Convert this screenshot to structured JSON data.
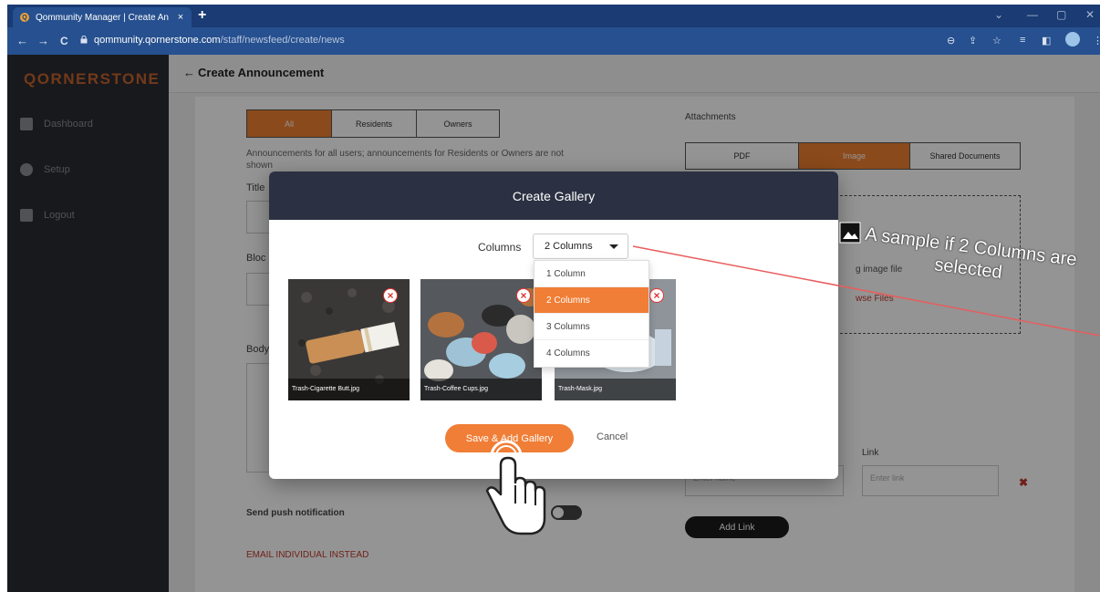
{
  "browser": {
    "tab_title": "Qommunity Manager | Create An",
    "tab_favicon": "Q",
    "tab_close": "×",
    "new_tab": "+",
    "url_host": "qommunity.qornerstone.com",
    "url_path": "/staff/newsfeed/create/news",
    "window_controls": [
      "⌄",
      "—",
      "▢",
      "✕"
    ],
    "nav": [
      "←",
      "→",
      "C"
    ]
  },
  "sidebar": {
    "logo": "QORNERSTONE",
    "items": [
      {
        "label": "Dashboard",
        "icon": "home-icon"
      },
      {
        "label": "Setup",
        "icon": "gear-icon"
      },
      {
        "label": "Logout",
        "icon": "logout-icon"
      }
    ]
  },
  "header": {
    "back": "←",
    "title": "Create Announcement"
  },
  "form": {
    "audience_tabs": [
      "All",
      "Residents",
      "Owners"
    ],
    "audience_selected": "All",
    "audience_note": "Announcements for all users; announcements for Residents or Owners are not shown",
    "title_label": "Title",
    "block_label": "Bloc",
    "body_label": "Body",
    "attachments_label": "Attachments",
    "attachment_tabs": [
      "PDF",
      "Image",
      "Shared Documents"
    ],
    "attachment_selected": "Image",
    "dropzone_text": "g image file",
    "browse_files": "wse Files",
    "link_label": "Link",
    "link_name_placeholder": "Enter name",
    "link_url_placeholder": "Enter link",
    "add_link": "Add Link",
    "send_push": "Send push notification",
    "email_individual": "EMAIL INDIVIDUAL INSTEAD"
  },
  "modal": {
    "title": "Create Gallery",
    "columns_label": "Columns",
    "columns_value": "2 Columns",
    "column_options": [
      "1 Column",
      "2 Columns",
      "3 Columns",
      "4 Columns"
    ],
    "selected_option_index": 1,
    "images": [
      {
        "caption": "Trash-Cigarette Butt.jpg"
      },
      {
        "caption": "Trash-Coffee Cups.jpg"
      },
      {
        "caption": "Trash-Mask.jpg"
      }
    ],
    "delete_symbol": "×",
    "save_button": "Save & Add Gallery",
    "cancel_button": "Cancel"
  },
  "annotation": {
    "text": "A sample if 2 Columns are selected"
  },
  "colors": {
    "accent": "#f07e36",
    "modal_header": "#2b3142",
    "sidebar": "#2a2c33",
    "browser_bar": "#1a3b73"
  }
}
